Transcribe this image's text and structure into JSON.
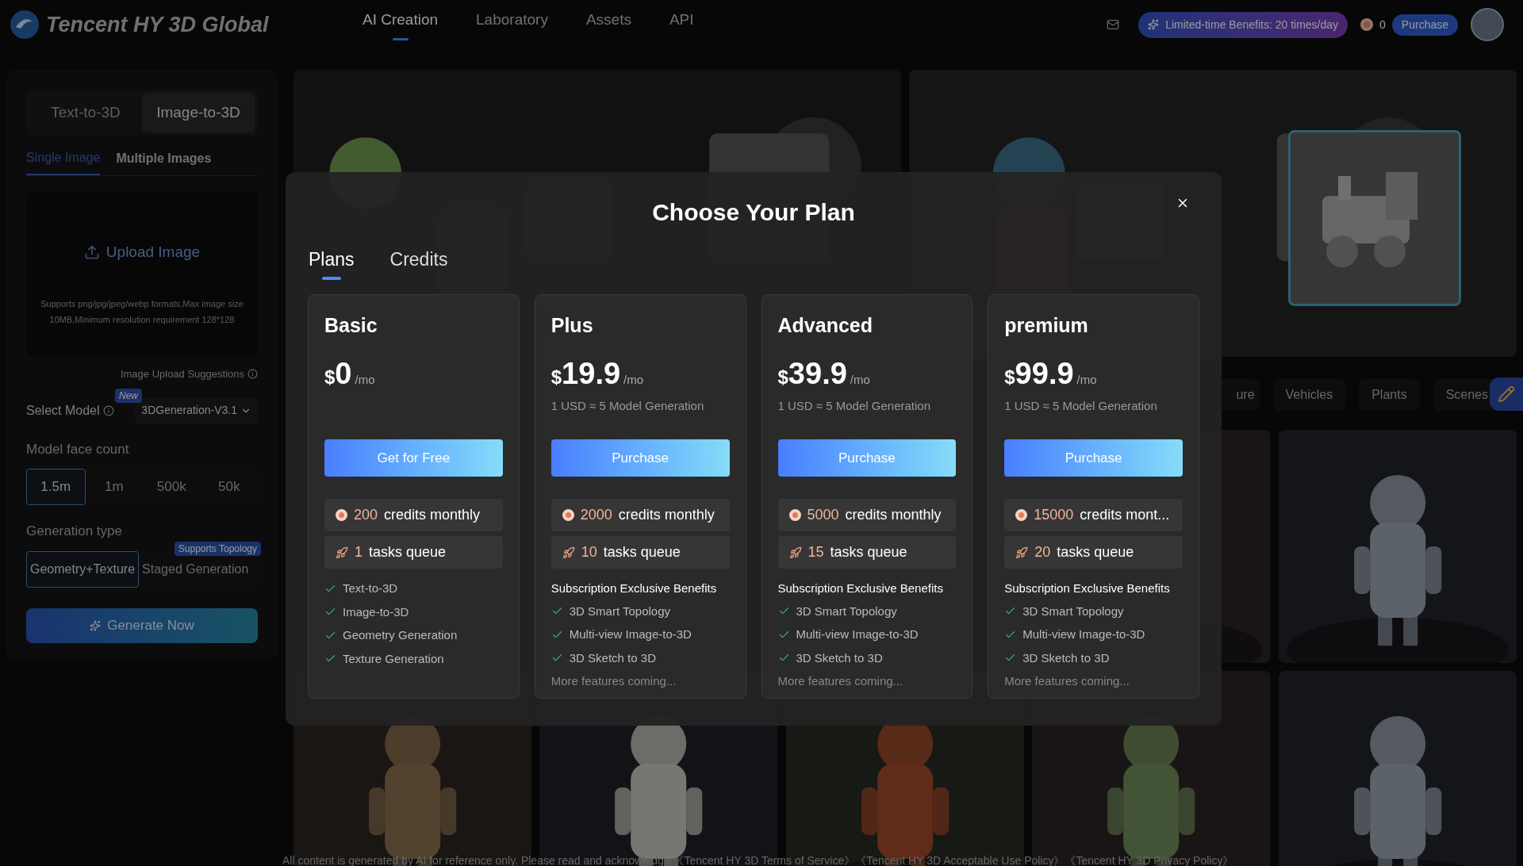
{
  "header": {
    "logo_text": "Tencent HY 3D Global",
    "nav": [
      {
        "label": "AI Creation",
        "selected": true
      },
      {
        "label": "Laboratory",
        "selected": false
      },
      {
        "label": "Assets",
        "selected": false
      },
      {
        "label": "API",
        "selected": false
      }
    ],
    "benefits": "Limited-time Benefits: 20 times/day",
    "credits": "0",
    "purchase": "Purchase"
  },
  "left": {
    "mode_tabs": [
      {
        "label": "Text-to-3D",
        "selected": false
      },
      {
        "label": "Image-to-3D",
        "selected": true
      }
    ],
    "image_tabs": [
      {
        "label": "Single Image",
        "selected": true
      },
      {
        "label": "Multiple Images",
        "selected": false
      }
    ],
    "upload": {
      "label": "Upload Image",
      "hint": "Supports png/jpg/jpeg/webp formats,Max image size 10MB,Minimum resolution requirement 128*128"
    },
    "suggestions": "Image Upload Suggestions",
    "model": {
      "label": "Select Model",
      "badge": "New",
      "value": "3DGeneration-V3.1"
    },
    "face_count": {
      "label": "Model face count",
      "options": [
        {
          "label": "1.5m",
          "selected": true
        },
        {
          "label": "1m",
          "selected": false
        },
        {
          "label": "500k",
          "selected": false
        },
        {
          "label": "50k",
          "selected": false
        }
      ]
    },
    "generation_type": {
      "label": "Generation type",
      "badge": "Supports Topology",
      "options": [
        {
          "label": "Geometry+Texture",
          "selected": true
        },
        {
          "label": "Staged Generation",
          "selected": false
        }
      ]
    },
    "generate": "Generate Now"
  },
  "gallery": {
    "categories": [
      "ure",
      "Vehicles",
      "Plants",
      "Scenes"
    ]
  },
  "modal": {
    "title": "Choose Your Plan",
    "tabs": [
      {
        "label": "Plans",
        "selected": true
      },
      {
        "label": "Credits",
        "selected": false
      }
    ],
    "plans": [
      {
        "name": "Basic",
        "currency": "$",
        "price": "0",
        "unit": "/mo",
        "button": "Get for Free",
        "credits": "200",
        "credits_label": "credits monthly",
        "queue": "1",
        "queue_label": "tasks queue",
        "features": [
          "Text-to-3D",
          "Image-to-3D",
          "Geometry Generation",
          "Texture Generation"
        ]
      },
      {
        "name": "Plus",
        "currency": "$",
        "price": "19.9",
        "unit": "/mo",
        "note": "1 USD ≈ 5 Model Generation",
        "button": "Purchase",
        "credits": "2000",
        "credits_label": "credits monthly",
        "queue": "10",
        "queue_label": "tasks queue",
        "benefits_title": "Subscription Exclusive Benefits",
        "features": [
          "3D Smart Topology",
          "Multi-view Image-to-3D",
          "3D Sketch to 3D"
        ],
        "more": "More features coming..."
      },
      {
        "name": "Advanced",
        "currency": "$",
        "price": "39.9",
        "unit": "/mo",
        "note": "1 USD ≈ 5 Model Generation",
        "button": "Purchase",
        "credits": "5000",
        "credits_label": "credits monthly",
        "queue": "15",
        "queue_label": "tasks queue",
        "benefits_title": "Subscription Exclusive Benefits",
        "features": [
          "3D Smart Topology",
          "Multi-view Image-to-3D",
          "3D Sketch to 3D"
        ],
        "more": "More features coming..."
      },
      {
        "name": "premium",
        "currency": "$",
        "price": "99.9",
        "unit": "/mo",
        "note": "1 USD ≈ 5 Model Generation",
        "button": "Purchase",
        "credits": "15000",
        "credits_label": "credits mont...",
        "queue": "20",
        "queue_label": "tasks queue",
        "benefits_title": "Subscription Exclusive Benefits",
        "features": [
          "3D Smart Topology",
          "Multi-view Image-to-3D",
          "3D Sketch to 3D"
        ],
        "more": "More features coming..."
      }
    ]
  },
  "footer": "All content is generated by AI for reference only. Please read and acknowledge:《Tencent HY 3D Terms of Service》《Tencent HY 3D Acceptable Use Policy》《Tencent HY 3D Privacy Policy》"
}
